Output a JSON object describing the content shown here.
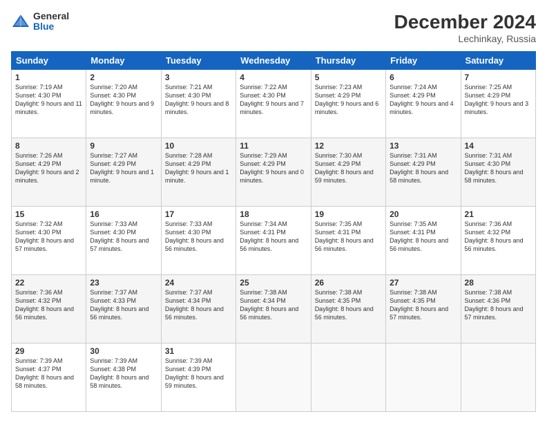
{
  "header": {
    "logo_general": "General",
    "logo_blue": "Blue",
    "main_title": "December 2024",
    "subtitle": "Lechinkay, Russia"
  },
  "columns": [
    "Sunday",
    "Monday",
    "Tuesday",
    "Wednesday",
    "Thursday",
    "Friday",
    "Saturday"
  ],
  "rows": [
    [
      {
        "day": "1",
        "sunrise": "Sunrise: 7:19 AM",
        "sunset": "Sunset: 4:30 PM",
        "daylight": "Daylight: 9 hours and 11 minutes."
      },
      {
        "day": "2",
        "sunrise": "Sunrise: 7:20 AM",
        "sunset": "Sunset: 4:30 PM",
        "daylight": "Daylight: 9 hours and 9 minutes."
      },
      {
        "day": "3",
        "sunrise": "Sunrise: 7:21 AM",
        "sunset": "Sunset: 4:30 PM",
        "daylight": "Daylight: 9 hours and 8 minutes."
      },
      {
        "day": "4",
        "sunrise": "Sunrise: 7:22 AM",
        "sunset": "Sunset: 4:30 PM",
        "daylight": "Daylight: 9 hours and 7 minutes."
      },
      {
        "day": "5",
        "sunrise": "Sunrise: 7:23 AM",
        "sunset": "Sunset: 4:29 PM",
        "daylight": "Daylight: 9 hours and 6 minutes."
      },
      {
        "day": "6",
        "sunrise": "Sunrise: 7:24 AM",
        "sunset": "Sunset: 4:29 PM",
        "daylight": "Daylight: 9 hours and 4 minutes."
      },
      {
        "day": "7",
        "sunrise": "Sunrise: 7:25 AM",
        "sunset": "Sunset: 4:29 PM",
        "daylight": "Daylight: 9 hours and 3 minutes."
      }
    ],
    [
      {
        "day": "8",
        "sunrise": "Sunrise: 7:26 AM",
        "sunset": "Sunset: 4:29 PM",
        "daylight": "Daylight: 9 hours and 2 minutes."
      },
      {
        "day": "9",
        "sunrise": "Sunrise: 7:27 AM",
        "sunset": "Sunset: 4:29 PM",
        "daylight": "Daylight: 9 hours and 1 minute."
      },
      {
        "day": "10",
        "sunrise": "Sunrise: 7:28 AM",
        "sunset": "Sunset: 4:29 PM",
        "daylight": "Daylight: 9 hours and 1 minute."
      },
      {
        "day": "11",
        "sunrise": "Sunrise: 7:29 AM",
        "sunset": "Sunset: 4:29 PM",
        "daylight": "Daylight: 9 hours and 0 minutes."
      },
      {
        "day": "12",
        "sunrise": "Sunrise: 7:30 AM",
        "sunset": "Sunset: 4:29 PM",
        "daylight": "Daylight: 8 hours and 59 minutes."
      },
      {
        "day": "13",
        "sunrise": "Sunrise: 7:31 AM",
        "sunset": "Sunset: 4:29 PM",
        "daylight": "Daylight: 8 hours and 58 minutes."
      },
      {
        "day": "14",
        "sunrise": "Sunrise: 7:31 AM",
        "sunset": "Sunset: 4:30 PM",
        "daylight": "Daylight: 8 hours and 58 minutes."
      }
    ],
    [
      {
        "day": "15",
        "sunrise": "Sunrise: 7:32 AM",
        "sunset": "Sunset: 4:30 PM",
        "daylight": "Daylight: 8 hours and 57 minutes."
      },
      {
        "day": "16",
        "sunrise": "Sunrise: 7:33 AM",
        "sunset": "Sunset: 4:30 PM",
        "daylight": "Daylight: 8 hours and 57 minutes."
      },
      {
        "day": "17",
        "sunrise": "Sunrise: 7:33 AM",
        "sunset": "Sunset: 4:30 PM",
        "daylight": "Daylight: 8 hours and 56 minutes."
      },
      {
        "day": "18",
        "sunrise": "Sunrise: 7:34 AM",
        "sunset": "Sunset: 4:31 PM",
        "daylight": "Daylight: 8 hours and 56 minutes."
      },
      {
        "day": "19",
        "sunrise": "Sunrise: 7:35 AM",
        "sunset": "Sunset: 4:31 PM",
        "daylight": "Daylight: 8 hours and 56 minutes."
      },
      {
        "day": "20",
        "sunrise": "Sunrise: 7:35 AM",
        "sunset": "Sunset: 4:31 PM",
        "daylight": "Daylight: 8 hours and 56 minutes."
      },
      {
        "day": "21",
        "sunrise": "Sunrise: 7:36 AM",
        "sunset": "Sunset: 4:32 PM",
        "daylight": "Daylight: 8 hours and 56 minutes."
      }
    ],
    [
      {
        "day": "22",
        "sunrise": "Sunrise: 7:36 AM",
        "sunset": "Sunset: 4:32 PM",
        "daylight": "Daylight: 8 hours and 56 minutes."
      },
      {
        "day": "23",
        "sunrise": "Sunrise: 7:37 AM",
        "sunset": "Sunset: 4:33 PM",
        "daylight": "Daylight: 8 hours and 56 minutes."
      },
      {
        "day": "24",
        "sunrise": "Sunrise: 7:37 AM",
        "sunset": "Sunset: 4:34 PM",
        "daylight": "Daylight: 8 hours and 56 minutes."
      },
      {
        "day": "25",
        "sunrise": "Sunrise: 7:38 AM",
        "sunset": "Sunset: 4:34 PM",
        "daylight": "Daylight: 8 hours and 56 minutes."
      },
      {
        "day": "26",
        "sunrise": "Sunrise: 7:38 AM",
        "sunset": "Sunset: 4:35 PM",
        "daylight": "Daylight: 8 hours and 56 minutes."
      },
      {
        "day": "27",
        "sunrise": "Sunrise: 7:38 AM",
        "sunset": "Sunset: 4:35 PM",
        "daylight": "Daylight: 8 hours and 57 minutes."
      },
      {
        "day": "28",
        "sunrise": "Sunrise: 7:38 AM",
        "sunset": "Sunset: 4:36 PM",
        "daylight": "Daylight: 8 hours and 57 minutes."
      }
    ],
    [
      {
        "day": "29",
        "sunrise": "Sunrise: 7:39 AM",
        "sunset": "Sunset: 4:37 PM",
        "daylight": "Daylight: 8 hours and 58 minutes."
      },
      {
        "day": "30",
        "sunrise": "Sunrise: 7:39 AM",
        "sunset": "Sunset: 4:38 PM",
        "daylight": "Daylight: 8 hours and 58 minutes."
      },
      {
        "day": "31",
        "sunrise": "Sunrise: 7:39 AM",
        "sunset": "Sunset: 4:39 PM",
        "daylight": "Daylight: 8 hours and 59 minutes."
      },
      null,
      null,
      null,
      null
    ]
  ]
}
